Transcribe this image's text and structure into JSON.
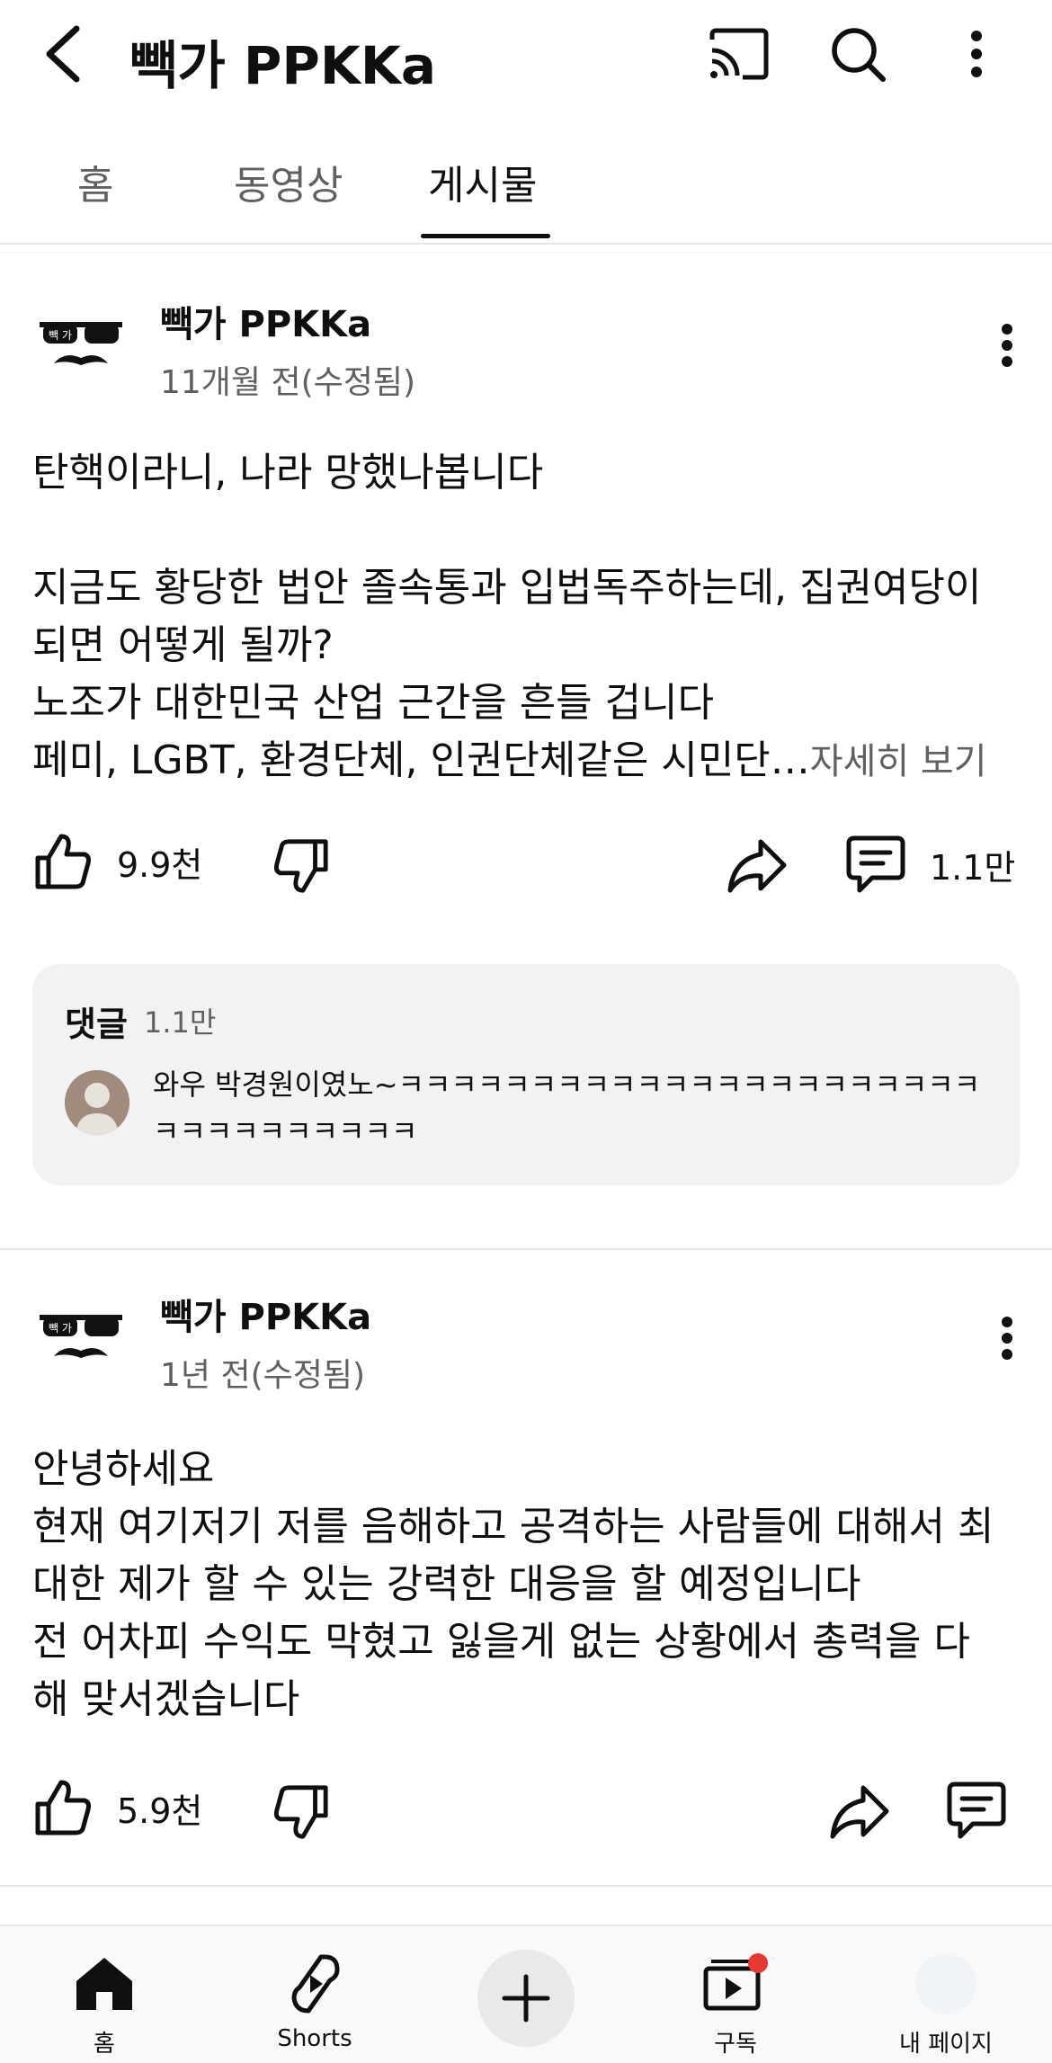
{
  "appbar": {
    "title": "빽가 PPKKa",
    "icons": [
      "back-arrow-icon",
      "cast-icon",
      "search-icon",
      "more-vert-icon"
    ]
  },
  "tabs": {
    "items": [
      "홈",
      "동영상",
      "게시물"
    ],
    "selected": "게시물"
  },
  "posts": [
    {
      "author": "빽가 PPKKa",
      "avatar_text": "빽 가",
      "time": "11개월 전(수정됨)",
      "lines": [
        "탄핵이라니, 나라 망했나봅니다",
        "",
        "지금도 황당한 법안 졸속통과 입법독주하는데, 집권여당이",
        "되면 어떻게 될까?",
        "노조가 대한민국 산업 근간을 흔들 겁니다",
        "페미, LGBT, 환경단체, 인권단체같은 시민단…"
      ],
      "read_more": "자세히 보기",
      "likes": "9.9천",
      "comments": "1.1만",
      "comment_preview": {
        "title": "댓글",
        "count": "1.1만",
        "text": "와우 박경원이였노~ㅋㅋㅋㅋㅋㅋㅋㅋㅋㅋㅋㅋㅋㅋㅋㅋㅋㅋㅋㅋㅋㅋㅋㅋㅋㅋㅋㅋㅋㅋㅋㅋ"
      }
    },
    {
      "author": "빽가 PPKKa",
      "avatar_text": "빽 가",
      "time": "1년 전(수정됨)",
      "lines": [
        "안녕하세요",
        "현재 여기저기 저를 음해하고 공격하는 사람들에 대해서 최",
        "대한 제가 할 수 있는 강력한 대응을 할 예정입니다",
        "전 어차피 수익도 막혔고  잃을게 없는 상황에서 총력을 다",
        "해 맞서겠습니다"
      ],
      "likes": "5.9천"
    }
  ],
  "bottom_nav": {
    "home": "홈",
    "shorts": "Shorts",
    "subscriptions": "구독",
    "me": "내 페이지"
  },
  "colors": {
    "accent": "#0f0f0f",
    "secondary_text": "#606060",
    "notification_dot": "#e53935",
    "card_bg": "#f2f2f2"
  }
}
